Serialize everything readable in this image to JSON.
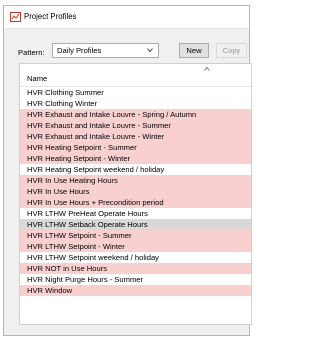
{
  "window": {
    "title": "Project Profiles"
  },
  "toolbar": {
    "pattern_label": "Pattern:",
    "pattern_value": "Daily Profiles",
    "new_label": "New",
    "copy_label": "Copy"
  },
  "list": {
    "column_header": "Name",
    "highlight_color": "#f9d0d0",
    "selected_color": "#d9d9d9",
    "rows": [
      {
        "label": "HVR Clothing Summer",
        "state": "normal"
      },
      {
        "label": "HVR Clothing Winter",
        "state": "normal"
      },
      {
        "label": "HVR Exhaust and Intake Louvre - Spring / Autumn",
        "state": "highlighted"
      },
      {
        "label": "HVR Exhaust and Intake Louvre - Summer",
        "state": "highlighted"
      },
      {
        "label": "HVR Exhaust and Intake Louvre - Winter",
        "state": "highlighted"
      },
      {
        "label": "HVR Heating Setpoint - Summer",
        "state": "highlighted"
      },
      {
        "label": "HVR Heating Setpoint - Winter",
        "state": "highlighted"
      },
      {
        "label": "HVR Heating Setpoint weekend / holiday",
        "state": "normal"
      },
      {
        "label": "HVR In Use Heating Hours",
        "state": "highlighted"
      },
      {
        "label": "HVR In Use Hours",
        "state": "highlighted"
      },
      {
        "label": "HVR In Use Hours + Precondition period",
        "state": "highlighted"
      },
      {
        "label": "HVR LTHW PreHeat Operate Hours",
        "state": "normal"
      },
      {
        "label": "HVR LTHW Setback Operate Hours",
        "state": "selected"
      },
      {
        "label": "HVR LTHW Setpoint - Summer",
        "state": "highlighted"
      },
      {
        "label": "HVR LTHW Setpoint - Winter",
        "state": "highlighted"
      },
      {
        "label": "HVR LTHW Setpoint weekend / holiday",
        "state": "normal"
      },
      {
        "label": "HVR NOT in Use Hours",
        "state": "highlighted"
      },
      {
        "label": "HVR Night Purge Hours - Summer",
        "state": "normal"
      },
      {
        "label": "HVR Window",
        "state": "highlighted"
      }
    ]
  }
}
